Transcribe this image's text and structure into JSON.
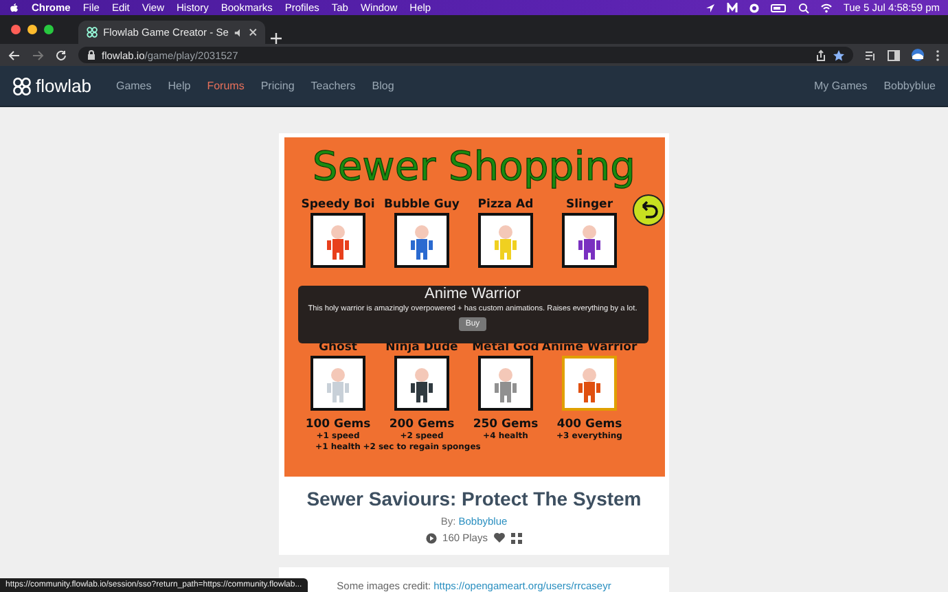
{
  "menu_bar": {
    "app": "Chrome",
    "menus": [
      "File",
      "Edit",
      "View",
      "History",
      "Bookmarks",
      "Profiles",
      "Tab",
      "Window",
      "Help"
    ],
    "clock": "Tue 5 Jul  4:58:59 pm"
  },
  "browser": {
    "tab_title": "Flowlab Game Creator - Se",
    "url_host": "flowlab.io",
    "url_path": "/game/play/2031527"
  },
  "site_nav": {
    "logo": "flowlab",
    "links": [
      {
        "label": "Games",
        "selected": false
      },
      {
        "label": "Help",
        "selected": false
      },
      {
        "label": "Forums",
        "selected": true
      },
      {
        "label": "Pricing",
        "selected": false
      },
      {
        "label": "Teachers",
        "selected": false
      },
      {
        "label": "Blog",
        "selected": false
      }
    ],
    "right_links": [
      "My Games",
      "Bobbyblue"
    ]
  },
  "game": {
    "title": "Sewer Shopping",
    "rows": [
      {
        "items": [
          {
            "name": "Speedy Boi",
            "color": "#e8401c",
            "selected": false
          },
          {
            "name": "Bubble Guy",
            "color": "#2a6ad0",
            "selected": false
          },
          {
            "name": "Pizza Ad",
            "color": "#f0d020",
            "selected": false
          },
          {
            "name": "Slinger",
            "color": "#7a30c0",
            "selected": false
          }
        ]
      },
      {
        "items": [
          {
            "name": "Ghost",
            "color": "#c8d0d8",
            "selected": false,
            "price": "100 Gems",
            "bonuses": [
              "+1 speed",
              "+1 health"
            ]
          },
          {
            "name": "Ninja Dude",
            "color": "#303a40",
            "selected": false,
            "price": "200 Gems",
            "bonuses": [
              "+2 speed",
              "+2 sec to regain sponges"
            ]
          },
          {
            "name": "Metal God",
            "color": "#909090",
            "selected": false,
            "price": "250 Gems",
            "bonuses": [
              "+4 health"
            ]
          },
          {
            "name": "Anime Warrior",
            "color": "#e05010",
            "selected": true,
            "price": "400 Gems",
            "bonuses": [
              "+3 everything"
            ]
          }
        ]
      }
    ],
    "popup": {
      "title": "Anime Warrior",
      "description": "This holy warrior is amazingly overpowered + has custom animations. Raises everything by a lot.",
      "button": "Buy"
    }
  },
  "game_info": {
    "title": "Sewer Saviours: Protect The System",
    "by_label": "By:",
    "author": "Bobbyblue",
    "plays": "160 Plays"
  },
  "credits": {
    "label": "Some images credit:",
    "link": "https://opengameart.org/users/rrcaseyr"
  },
  "status_url": "https://community.flowlab.io/session/sso?return_path=https://community.flowlab..."
}
